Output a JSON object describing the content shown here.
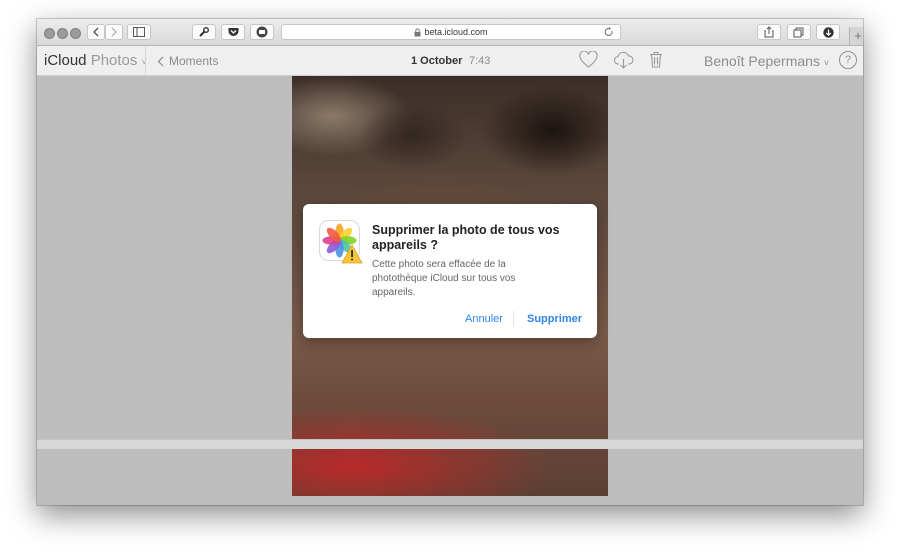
{
  "browser": {
    "url": "beta.icloud.com",
    "new_tab_label": "+"
  },
  "app": {
    "brand": "iCloud",
    "section": "Photos",
    "section_chevron": "˅"
  },
  "header": {
    "back_label": "Moments",
    "date": "1 October",
    "time": "7:43",
    "user_name": "Benoît Pepermans",
    "user_chevron": "˅",
    "help_label": "?"
  },
  "icons": {
    "favorite": "heart-icon",
    "download": "cloud-download-icon",
    "delete": "trash-icon"
  },
  "dialog": {
    "title": "Supprimer la photo de tous vos appareils ?",
    "message": "Cette photo sera effacée de la photothèque iCloud sur tous vos appareils.",
    "cancel_label": "Annuler",
    "confirm_label": "Supprimer",
    "accent_color": "#2f86ea",
    "icon": "photos-app-warning-icon"
  }
}
